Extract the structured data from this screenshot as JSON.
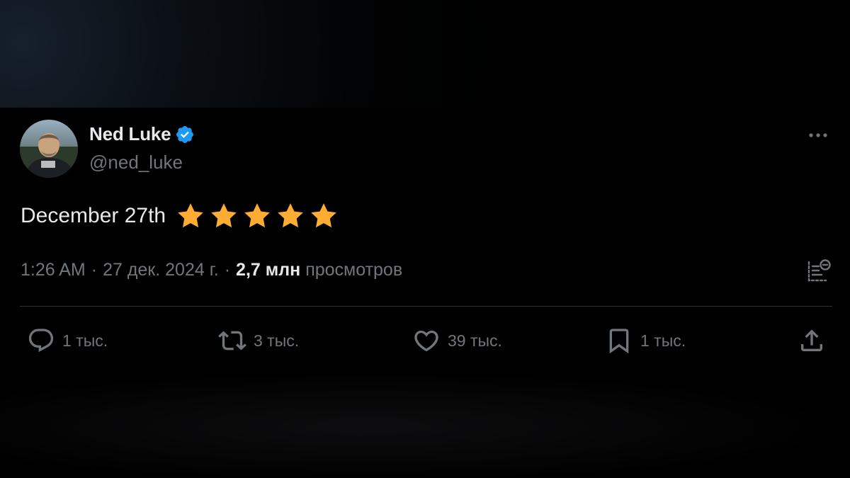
{
  "author": {
    "display_name": "Ned Luke",
    "handle": "@ned_luke",
    "verified": true
  },
  "tweet": {
    "text": "December 27th",
    "star_rating": 5,
    "time": "1:26 AM",
    "separator": "·",
    "date": "27 дек. 2024 г.",
    "views_count": "2,7 млн",
    "views_label": "просмотров"
  },
  "actions": {
    "replies": "1 тыс.",
    "reposts": "3 тыс.",
    "likes": "39 тыс.",
    "bookmarks": "1 тыс."
  },
  "colors": {
    "background": "#000000",
    "primary_text": "#e7e9ea",
    "secondary_text": "#71767b",
    "verified_blue": "#1d9bf0",
    "star": "#ffac33",
    "divider": "#2f3336"
  },
  "icons": [
    "verified-badge-icon",
    "more-icon",
    "star-icon",
    "analytics-icon",
    "reply-icon",
    "repost-icon",
    "like-icon",
    "bookmark-icon",
    "share-icon"
  ]
}
